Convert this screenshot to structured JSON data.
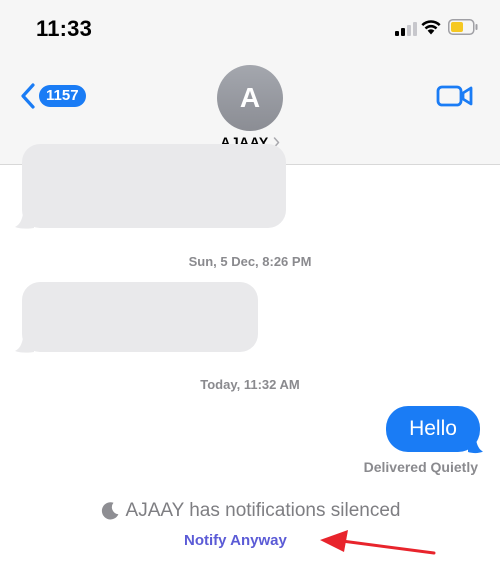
{
  "status_bar": {
    "time": "11:33"
  },
  "header": {
    "back_count": "1157",
    "avatar_initial": "A",
    "contact_name": "AJAAY"
  },
  "messages": {
    "timestamp_1": "Sun, 5 Dec, 8:26 PM",
    "timestamp_2": "Today, 11:32 AM",
    "sent_text": "Hello",
    "delivery_status": "Delivered Quietly"
  },
  "focus_notice": {
    "silenced_text": "AJAAY has notifications silenced",
    "notify_label": "Notify Anyway"
  },
  "colors": {
    "accent_blue": "#1a7cf5",
    "notify_purple": "#5b5bd6",
    "bubble_gray": "#e9e9eb",
    "arrow_red": "#e8242c",
    "battery_yellow": "#f5c823"
  }
}
